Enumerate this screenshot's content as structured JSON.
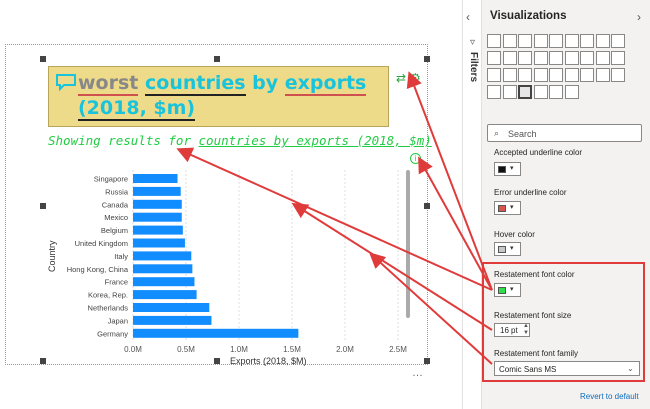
{
  "visual": {
    "qa_words": [
      {
        "text": "worst",
        "style": "gray",
        "underline": "red"
      },
      {
        "text": "countries",
        "style": "cyan",
        "underline": "black"
      },
      {
        "text": "by",
        "style": "cyan",
        "underline": "none"
      },
      {
        "text": "exports",
        "style": "cyan",
        "underline": "red"
      },
      {
        "text": "(2018, $m)",
        "style": "cyan",
        "underline": "black"
      }
    ],
    "restatement_prefix": "Showing results for",
    "restatement_link": "countries by exports (2018, $m)",
    "more_options": "…"
  },
  "chart_data": {
    "type": "bar",
    "orientation": "horizontal",
    "ylabel": "Country",
    "xlabel": "Exports (2018, $M)",
    "categories": [
      "Singapore",
      "Russia",
      "Canada",
      "Mexico",
      "Belgium",
      "United Kingdom",
      "Italy",
      "Hong Kong, China",
      "France",
      "Korea, Rep.",
      "Netherlands",
      "Japan",
      "Germany"
    ],
    "values": [
      0.42,
      0.45,
      0.46,
      0.46,
      0.47,
      0.49,
      0.55,
      0.56,
      0.58,
      0.6,
      0.72,
      0.74,
      1.56
    ],
    "xticks": [
      "0.0M",
      "0.5M",
      "1.0M",
      "1.5M",
      "2.0M",
      "2.5M"
    ],
    "xlim": [
      0,
      2.5
    ],
    "bar_color": "#118dff",
    "grid": "vertical dotted"
  },
  "filters": {
    "label": "Filters"
  },
  "viz_pane": {
    "title": "Visualizations",
    "search_placeholder": "Search",
    "props": [
      {
        "label": "Accepted underline color",
        "color": "#111111"
      },
      {
        "label": "Error underline color",
        "color": "#d9534f"
      },
      {
        "label": "Hover color",
        "color": "#c8c8c8"
      },
      {
        "label": "Restatement font color",
        "color": "#2ee04a"
      }
    ],
    "font_size_label": "Restatement font size",
    "font_size_value": "16",
    "font_size_unit": "pt",
    "font_family_label": "Restatement font family",
    "font_family_value": "Comic Sans MS",
    "revert": "Revert to default"
  },
  "colors": {
    "accent_red": "#e03b3b",
    "restatement_green": "#22cc44"
  }
}
